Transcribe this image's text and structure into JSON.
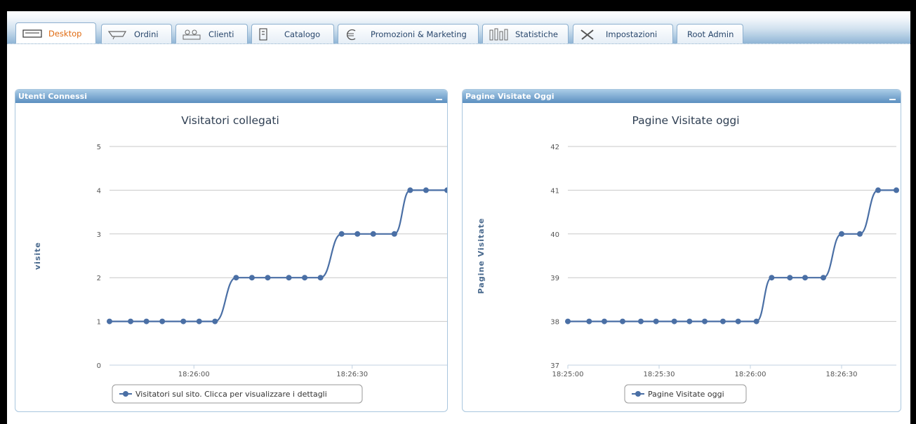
{
  "tabs": [
    {
      "label": "Desktop",
      "icon": "desktop-icon",
      "active": true
    },
    {
      "label": "Ordini",
      "icon": "cart-icon"
    },
    {
      "label": "Clienti",
      "icon": "users-icon"
    },
    {
      "label": "Catalogo",
      "icon": "catalog-icon"
    },
    {
      "label": "Promozioni & Marketing",
      "icon": "euro-icon"
    },
    {
      "label": "Statistiche",
      "icon": "stats-icon"
    },
    {
      "label": "Impostazioni",
      "icon": "tools-icon"
    },
    {
      "label": "Root Admin",
      "icon": ""
    }
  ],
  "panels": {
    "left": {
      "title": "Utenti Connessi"
    },
    "right": {
      "title": "Pagine Visitate Oggi"
    }
  },
  "colors": {
    "accent": "#e06a10",
    "series": "#4a6fa5",
    "header": "#5b8fc0"
  },
  "chart_data": [
    {
      "type": "line",
      "title": "Visitatori collegati",
      "xlabel": "",
      "ylabel": "visite",
      "ylim": [
        0,
        5
      ],
      "yticks": [
        "0",
        "1",
        "2",
        "3",
        "4",
        "5"
      ],
      "xlim": [
        "18:25:44",
        "18:26:48"
      ],
      "xticks": [
        "18:26:00",
        "18:26:30"
      ],
      "grid": true,
      "legend_position": "bottom",
      "series": [
        {
          "name": "Visitatori sul sito. Clicca per visualizzare i dettagli",
          "x": [
            "18:25:44",
            "18:25:48",
            "18:25:51",
            "18:25:54",
            "18:25:58",
            "18:26:01",
            "18:26:04",
            "18:26:08",
            "18:26:11",
            "18:26:14",
            "18:26:18",
            "18:26:21",
            "18:26:24",
            "18:26:28",
            "18:26:31",
            "18:26:34",
            "18:26:38",
            "18:26:41",
            "18:26:44",
            "18:26:48"
          ],
          "values": [
            1,
            1,
            1,
            1,
            1,
            1,
            1,
            2,
            2,
            2,
            2,
            2,
            2,
            3,
            3,
            3,
            3,
            4,
            4,
            4
          ]
        }
      ]
    },
    {
      "type": "line",
      "title": "Pagine Visitate oggi",
      "xlabel": "",
      "ylabel": "Pagine Visitate",
      "ylim": [
        37,
        42
      ],
      "yticks": [
        "37",
        "38",
        "39",
        "40",
        "41",
        "42"
      ],
      "xlim": [
        "18:25:00",
        "18:26:48"
      ],
      "xticks": [
        "18:25:00",
        "18:25:30",
        "18:26:00",
        "18:26:30"
      ],
      "grid": true,
      "legend_position": "bottom",
      "series": [
        {
          "name": "Pagine Visitate oggi",
          "x": [
            "18:25:00",
            "18:25:07",
            "18:25:12",
            "18:25:18",
            "18:25:24",
            "18:25:29",
            "18:25:35",
            "18:25:40",
            "18:25:45",
            "18:25:51",
            "18:25:56",
            "18:26:02",
            "18:26:07",
            "18:26:13",
            "18:26:18",
            "18:26:24",
            "18:26:30",
            "18:26:36",
            "18:26:42",
            "18:26:48"
          ],
          "values": [
            38,
            38,
            38,
            38,
            38,
            38,
            38,
            38,
            38,
            38,
            38,
            38,
            39,
            39,
            39,
            39,
            40,
            40,
            41,
            41
          ]
        }
      ]
    }
  ]
}
